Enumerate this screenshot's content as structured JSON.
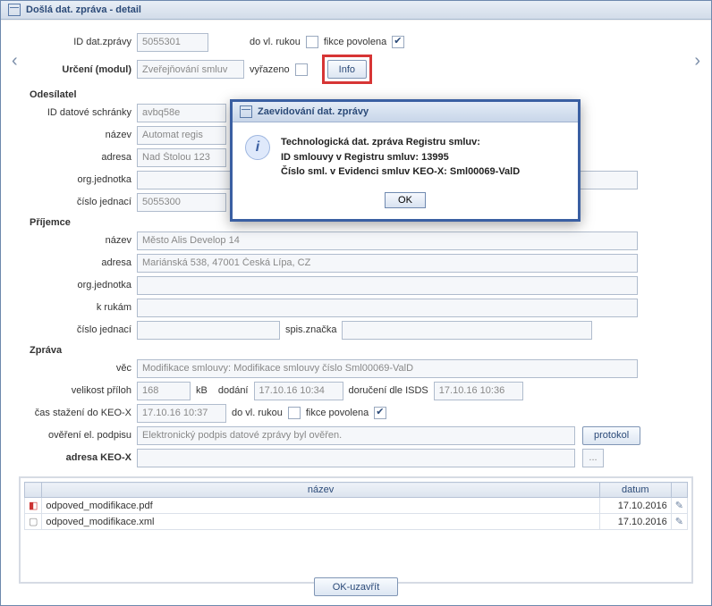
{
  "window": {
    "title": "Došlá dat. zpráva - detail"
  },
  "labels": {
    "id_dat_zpravy": "ID dat.zprávy",
    "do_vl_rukou": "do vl. rukou",
    "fikce_povolena": "fikce povolena",
    "urceni_modul": "Určení (modul)",
    "vyrazeno": "vyřazeno",
    "info_btn": "Info",
    "odesilatel": "Odesílatel",
    "id_ds": "ID datové schránky",
    "nazev": "název",
    "adresa": "adresa",
    "org_jednotka": "org.jednotka",
    "cislo_jednaci": "číslo jednací",
    "prijemce": "Příjemce",
    "k_rukam": "k rukám",
    "spis_znacka": "spis.značka",
    "zprava": "Zpráva",
    "vec": "věc",
    "velikost_priloh": "velikost příloh",
    "kb": "kB",
    "dodani": "dodání",
    "doruceni_isds": "doručení dle ISDS",
    "cas_stazeni": "čas stažení do KEO-X",
    "overeni_podpisu": "ověření el. podpisu",
    "protokol_btn": "protokol",
    "adresa_keox": "adresa KEO-X",
    "browse": "...",
    "col_nazev": "název",
    "col_datum": "datum",
    "ok_close": "OK-uzavřít"
  },
  "values": {
    "id_dat_zpravy": "5055301",
    "do_vl_rukou": false,
    "fikce_povolena": true,
    "urceni_modul": "Zveřejňování smluv",
    "vyrazeno": false,
    "sender": {
      "id_ds": "avbq58e",
      "nazev": "Automat regis",
      "adresa": "Nad Štolou 123",
      "org_jednotka": "",
      "cislo_jednaci": "5055300"
    },
    "recipient": {
      "nazev": "Město Alis Develop 14",
      "adresa": "Mariánská 538, 47001 Česká Lípa, CZ",
      "org_jednotka": "",
      "k_rukam": "",
      "cislo_jednaci": "",
      "spis_znacka": ""
    },
    "message": {
      "vec": "Modifikace smlouvy: Modifikace smlouvy číslo Sml00069-ValD",
      "velikost_priloh": "168",
      "dodani": "17.10.16 10:34",
      "doruceni_isds": "17.10.16 10:36",
      "cas_stazeni": "17.10.16 10:37",
      "do_vl_rukou": false,
      "fikce_povolena": true,
      "overeni_podpisu": "Elektronický podpis datové zprávy byl ověřen.",
      "adresa_keox": ""
    }
  },
  "attachments": [
    {
      "icon": "pdf",
      "name": "odpoved_modifikace.pdf",
      "date": "17.10.2016"
    },
    {
      "icon": "xml",
      "name": "odpoved_modifikace.xml",
      "date": "17.10.2016"
    }
  ],
  "modal": {
    "title": "Zaevidování dat. zprávy",
    "line1": "Technologická dat. zpráva Registru smluv:",
    "line2": "ID smlouvy v Registru smluv: 13995",
    "line3": "Číslo sml. v Evidenci smluv KEO-X: Sml00069-ValD",
    "ok": "OK"
  }
}
